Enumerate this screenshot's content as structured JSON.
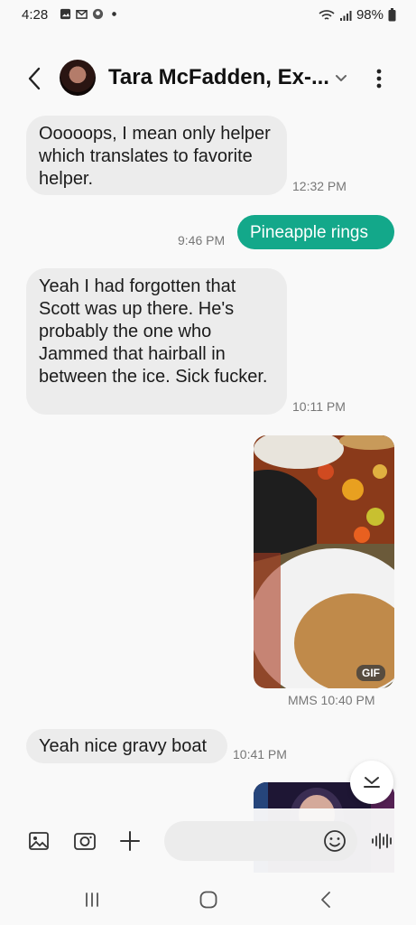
{
  "status_bar": {
    "time": "4:28",
    "battery": "98%"
  },
  "header": {
    "contact_name": "Tara McFadden, Ex-..."
  },
  "messages": [
    {
      "direction": "in",
      "text": "Ooooops, I mean only helper which translates to favorite helper.",
      "time": "12:32 PM"
    },
    {
      "direction": "out",
      "text": "Pineapple rings",
      "time": "9:46 PM"
    },
    {
      "direction": "in",
      "text": "Yeah I had forgotten that Scott was up there. He's probably the one who Jammed that hairball in between the ice. Sick fucker.",
      "time": "10:11 PM"
    },
    {
      "direction": "out",
      "type": "gif",
      "badge": "GIF",
      "time": "MMS 10:40 PM"
    },
    {
      "direction": "in",
      "text": "Yeah nice gravy boat",
      "time": "10:41 PM"
    }
  ],
  "input": {
    "placeholder": ""
  },
  "colors": {
    "accent": "#13a88a",
    "incoming_bubble": "#ececec",
    "background": "#f9f9f9"
  }
}
